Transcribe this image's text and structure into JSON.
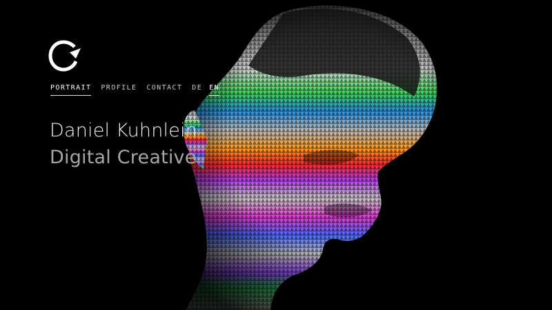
{
  "brand": {
    "logo_icon": "circle-c-logo-icon"
  },
  "nav": {
    "items": [
      {
        "label": "PORTRAIT",
        "active": true
      },
      {
        "label": "PROFILE",
        "active": false
      },
      {
        "label": "CONTACT",
        "active": false
      },
      {
        "label": "DE",
        "active": false
      },
      {
        "label": "EN",
        "active": true
      }
    ]
  },
  "hero": {
    "name": "Daniel Kuhnlein",
    "role": "Digital Creative"
  },
  "colors": {
    "background": "#000000",
    "text_primary": "#f2f2f2",
    "text_secondary": "#a6a6a6",
    "nav_text": "#c8c8c8"
  }
}
